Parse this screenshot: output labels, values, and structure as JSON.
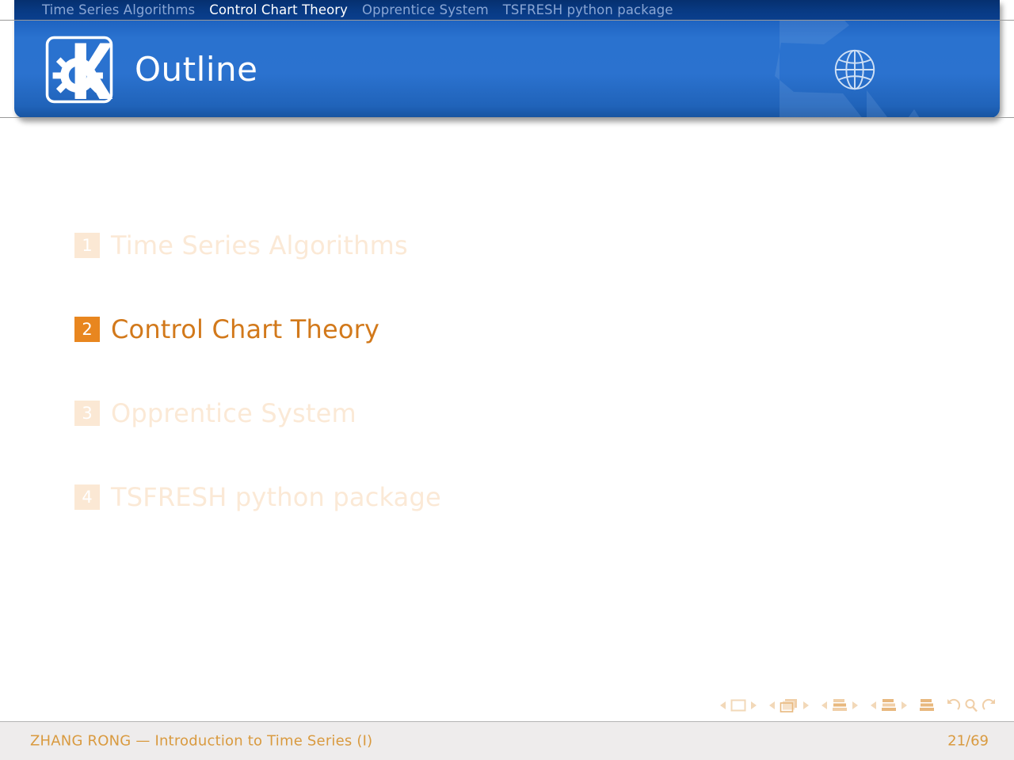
{
  "navbar": {
    "items": [
      {
        "label": "Time Series Algorithms",
        "state": "inactive"
      },
      {
        "label": "Control Chart Theory",
        "state": "active"
      },
      {
        "label": "Opprentice System",
        "state": "inactive"
      },
      {
        "label": "TSFRESH python package",
        "state": "inactive"
      }
    ]
  },
  "header": {
    "title": "Outline",
    "logo_icon": "kde-logo-icon",
    "globe_icon": "globe-icon",
    "watermark_icon": "kde-gear-watermark-icon",
    "background_color": "#2a72cf",
    "navbar_color": "#083a84"
  },
  "outline": {
    "items": [
      {
        "number": "1",
        "label": "Time Series Algorithms",
        "state": "faded"
      },
      {
        "number": "2",
        "label": "Control Chart Theory",
        "state": "current"
      },
      {
        "number": "3",
        "label": "Opprentice System",
        "state": "faded"
      },
      {
        "number": "4",
        "label": "TSFRESH python package",
        "state": "faded"
      }
    ],
    "accent_color": "#e8861f",
    "faded_color": "#fbe9d6"
  },
  "navigation_symbols": {
    "groups": [
      {
        "prev": "prev-slide-icon",
        "main": "slide-icon",
        "next": "next-slide-icon"
      },
      {
        "prev": "prev-frame-icon",
        "main": "frame-icon",
        "next": "next-frame-icon"
      },
      {
        "prev": "prev-subsection-icon",
        "main": "subsection-icon",
        "next": "next-subsection-icon"
      },
      {
        "prev": "prev-section-icon",
        "main": "section-icon",
        "next": "next-section-icon"
      }
    ],
    "doc_icon": "document-icon",
    "back_icon": "go-back-icon",
    "search_icon": "search-icon",
    "forward_icon": "go-forward-icon",
    "color": "#f4dcc0"
  },
  "footer": {
    "author_line": "ZHANG RONG — Introduction to Time Series (I)",
    "page": "21/69",
    "text_color": "#d99a3f",
    "background_color": "#eeecec"
  }
}
